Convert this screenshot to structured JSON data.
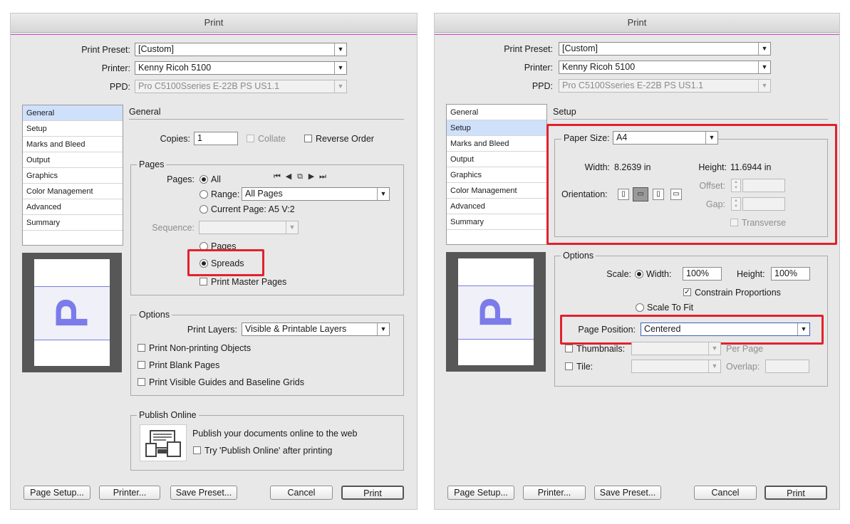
{
  "left": {
    "title": "Print",
    "print_preset_label": "Print Preset:",
    "print_preset_value": "[Custom]",
    "printer_label": "Printer:",
    "printer_value": "Kenny Ricoh 5100",
    "ppd_label": "PPD:",
    "ppd_value": "Pro C5100Sseries E-22B PS US1.1",
    "sections": [
      "General",
      "Setup",
      "Marks and Bleed",
      "Output",
      "Graphics",
      "Color Management",
      "Advanced",
      "Summary"
    ],
    "selected_section": "General",
    "heading": "General",
    "copies_label": "Copies:",
    "copies_value": "1",
    "collate_label": "Collate",
    "reverse_order_label": "Reverse Order",
    "pages_group": "Pages",
    "pages_label": "Pages:",
    "all_label": "All",
    "range_label": "Range:",
    "range_value": "All Pages",
    "current_page_label": "Current Page: A5 V:2",
    "sequence_label": "Sequence:",
    "pages_radio_label": "Pages",
    "spreads_label": "Spreads",
    "print_master_pages_label": "Print Master Pages",
    "options_group": "Options",
    "print_layers_label": "Print Layers:",
    "print_layers_value": "Visible & Printable Layers",
    "print_nonprinting_label": "Print Non-printing Objects",
    "print_blank_label": "Print Blank Pages",
    "print_guides_label": "Print Visible Guides and Baseline Grids",
    "publish_group": "Publish Online",
    "publish_text": "Publish your documents online to the web",
    "publish_try_label": "Try 'Publish Online' after printing",
    "preview_letter": "P",
    "buttons": {
      "page_setup": "Page Setup...",
      "printer": "Printer...",
      "save_preset": "Save Preset...",
      "cancel": "Cancel",
      "print": "Print"
    }
  },
  "right": {
    "title": "Print",
    "print_preset_label": "Print Preset:",
    "print_preset_value": "[Custom]",
    "printer_label": "Printer:",
    "printer_value": "Kenny Ricoh 5100",
    "ppd_label": "PPD:",
    "ppd_value": "Pro C5100Sseries E-22B PS US1.1",
    "sections": [
      "General",
      "Setup",
      "Marks and Bleed",
      "Output",
      "Graphics",
      "Color Management",
      "Advanced",
      "Summary"
    ],
    "selected_section": "Setup",
    "heading": "Setup",
    "paper_size_label": "Paper Size:",
    "paper_size_value": "A4",
    "width_label": "Width:",
    "width_value": "8.2639 in",
    "height_label": "Height:",
    "height_value": "11.6944 in",
    "orientation_label": "Orientation:",
    "offset_label": "Offset:",
    "gap_label": "Gap:",
    "transverse_label": "Transverse",
    "options_group": "Options",
    "scale_label": "Scale:",
    "scale_width_label": "Width:",
    "scale_width_value": "100%",
    "scale_height_label": "Height:",
    "scale_height_value": "100%",
    "constrain_label": "Constrain Proportions",
    "scale_to_fit_label": "Scale To Fit",
    "page_position_label": "Page Position:",
    "page_position_value": "Centered",
    "thumbnails_label": "Thumbnails:",
    "per_page_label": "Per Page",
    "tile_label": "Tile:",
    "overlap_label": "Overlap:",
    "preview_letter": "P",
    "buttons": {
      "page_setup": "Page Setup...",
      "printer": "Printer...",
      "save_preset": "Save Preset...",
      "cancel": "Cancel",
      "print": "Print"
    }
  },
  "colors": {
    "highlight_box": "#e0222e",
    "selection": "#cfe0fb",
    "preview_letter": "#7b7bea"
  }
}
